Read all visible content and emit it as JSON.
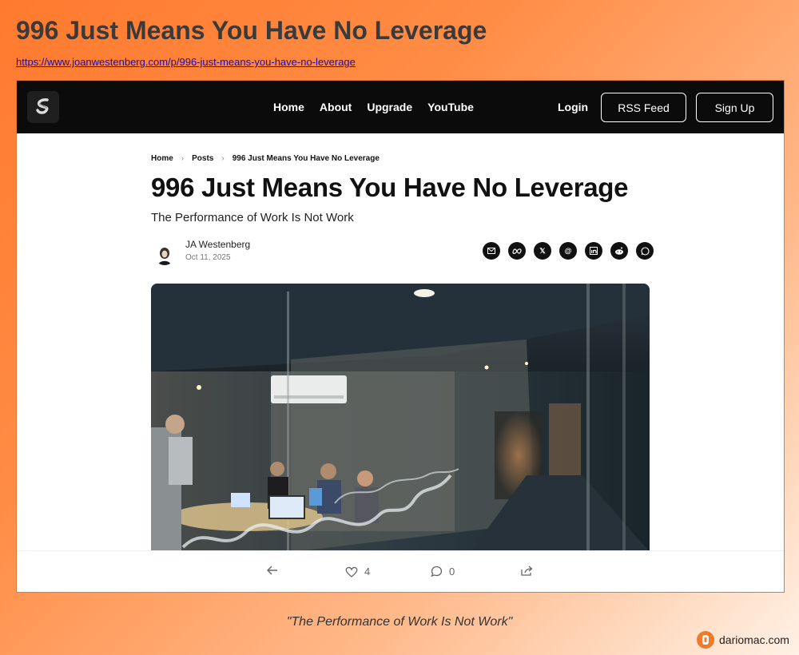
{
  "page": {
    "title": "996 Just Means You Have No Leverage",
    "url": "https://www.joanwestenberg.com/p/996-just-means-you-have-no-leverage",
    "caption": "\"The Performance of Work Is Not Work\"",
    "brand": "dariomac.com"
  },
  "nav": {
    "links": [
      "Home",
      "About",
      "Upgrade",
      "YouTube"
    ],
    "login": "Login",
    "rss": "RSS Feed",
    "signup": "Sign Up"
  },
  "breadcrumb": [
    "Home",
    "Posts",
    "996 Just Means You Have No Leverage"
  ],
  "article": {
    "title": "996 Just Means You Have No Leverage",
    "subtitle": "The Performance of Work Is Not Work",
    "author": "JA Westenberg",
    "date": "Oct 11, 2025"
  },
  "share": [
    "email-icon",
    "meta-icon",
    "x-icon",
    "threads-icon",
    "linkedin-icon",
    "reddit-icon",
    "whatsapp-icon"
  ],
  "bottom_bar": {
    "likes": "4",
    "comments": "0"
  },
  "colors": {
    "accent": "#ff7a2e",
    "nav_bg": "#0b0b0b"
  }
}
